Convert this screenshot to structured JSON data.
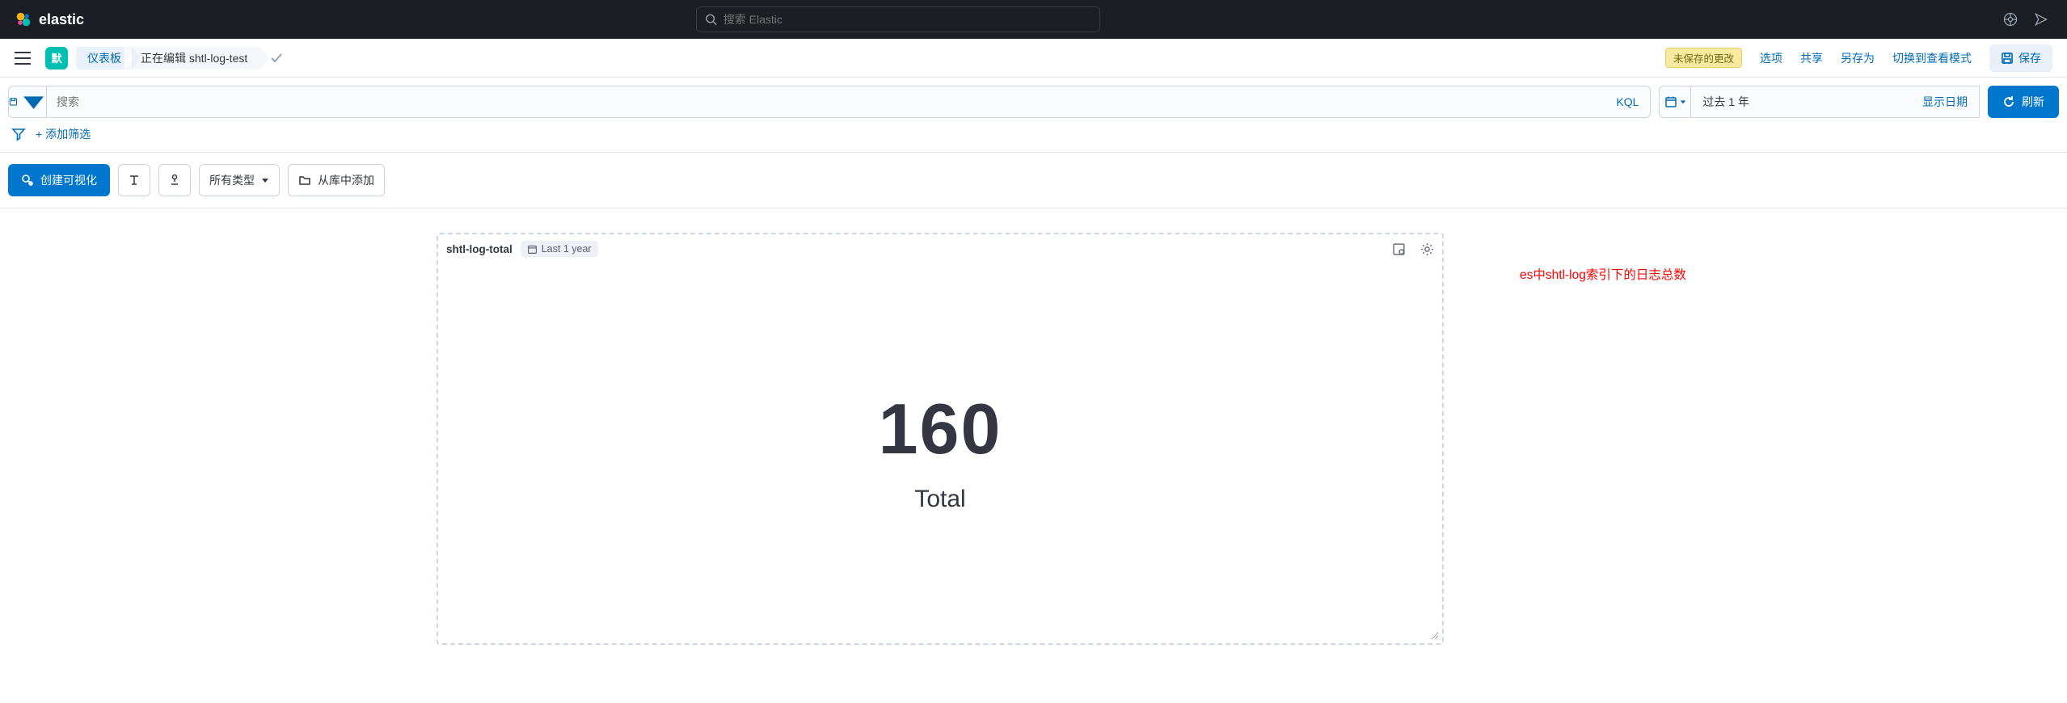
{
  "brand": {
    "name": "elastic"
  },
  "topnav": {
    "search_placeholder": "搜索 Elastic"
  },
  "subheader": {
    "space_badge": "默",
    "crumb_dashboard": "仪表板",
    "crumb_editing_prefix": "正在编辑",
    "crumb_editing_name": "shtl-log-test",
    "unsaved_label": "未保存的更改",
    "options": "选项",
    "share": "共享",
    "save_as": "另存为",
    "switch_view": "切换到查看模式",
    "save": "保存"
  },
  "querybar": {
    "search_placeholder": "搜索",
    "kql": "KQL",
    "date_range": "过去 1 年",
    "show_dates": "显示日期",
    "refresh": "刷新"
  },
  "filters": {
    "add_filter": "+ 添加筛选"
  },
  "toolbar": {
    "create_viz": "创建可视化",
    "all_types": "所有类型",
    "add_from_library": "从库中添加"
  },
  "panel": {
    "title": "shtl-log-total",
    "time_badge": "Last 1 year",
    "metric_value": "160",
    "metric_label": "Total"
  },
  "annotation": "es中shtl-log索引下的日志总数"
}
